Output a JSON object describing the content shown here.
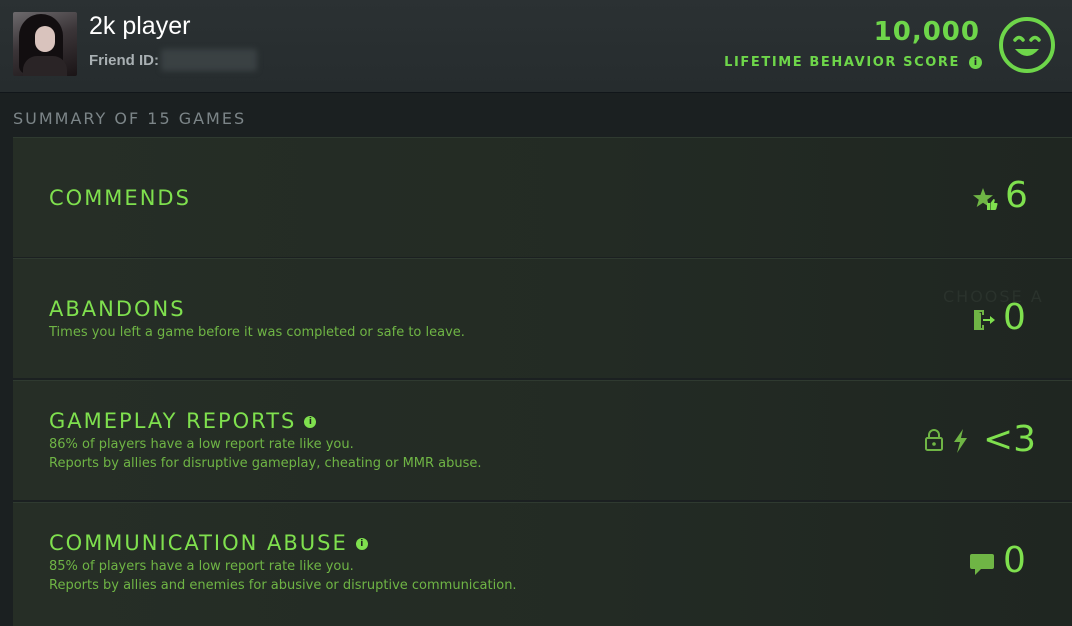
{
  "player": {
    "name": "2k player",
    "friend_id_label": "Friend ID:"
  },
  "behavior": {
    "score": "10,000",
    "label": "LIFETIME BEHAVIOR SCORE"
  },
  "summary": {
    "title": "SUMMARY OF 15 GAMES"
  },
  "cards": [
    {
      "title": "COMMENDS",
      "value": "6",
      "icon": "star-thumbs-up-icon"
    },
    {
      "title": "ABANDONS",
      "description": "Times you left a game before it was completed or safe to leave.",
      "value": "0",
      "icon": "exit-door-icon"
    },
    {
      "title": "GAMEPLAY REPORTS",
      "description_line1": "86% of players have a low report rate like you.",
      "description_line2": "Reports by allies for disruptive gameplay, cheating or MMR abuse.",
      "value": "<3",
      "icons": [
        "lock-icon",
        "lightning-icon"
      ]
    },
    {
      "title": "COMMUNICATION ABUSE",
      "description_line1": "85% of players have a low report rate like you.",
      "description_line2": "Reports by allies and enemies for abusive or disruptive communication.",
      "value": "0",
      "icon": "chat-bubble-icon"
    }
  ],
  "colors": {
    "accent": "#7fe04e",
    "score": "#6ed64a",
    "background": "#1b2021"
  }
}
